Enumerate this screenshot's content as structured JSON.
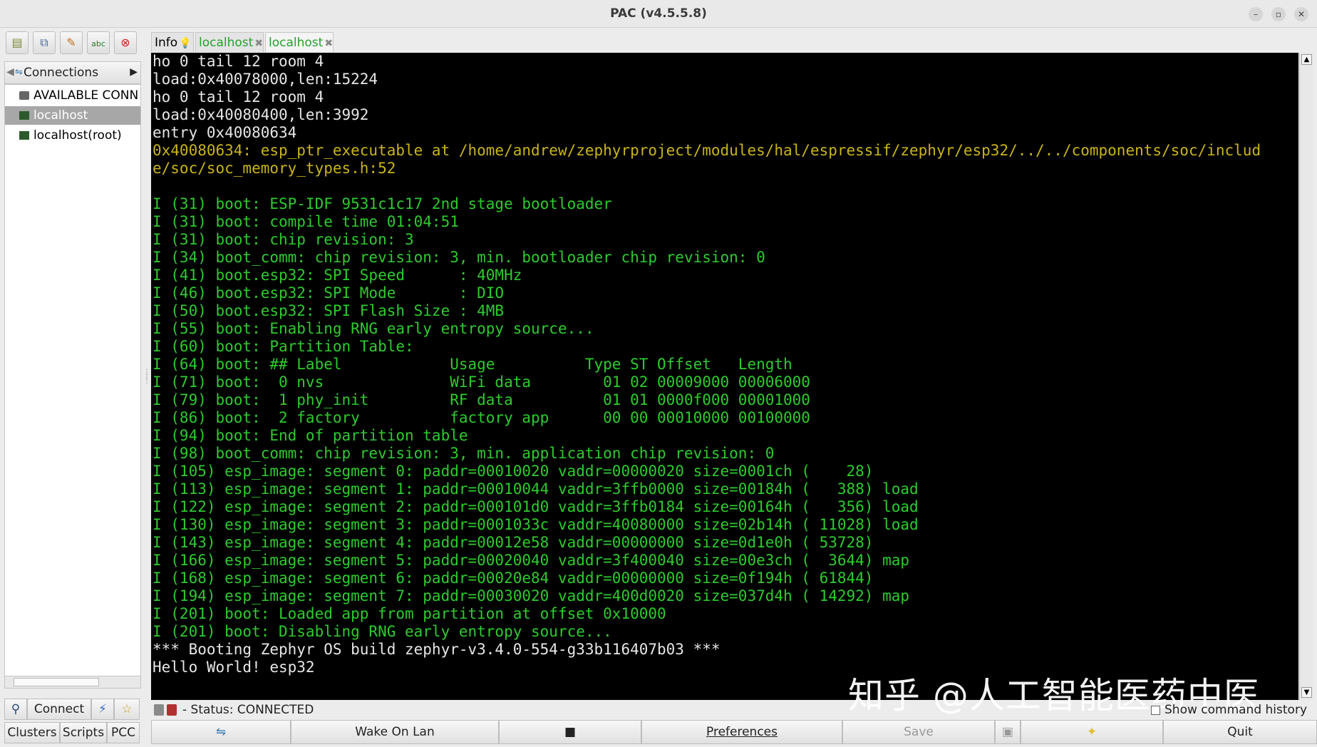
{
  "window": {
    "title": "PAC (v4.5.5.8)"
  },
  "left_panel": {
    "connections_label": "Connections",
    "tree": [
      {
        "label": "AVAILABLE CONN",
        "selected": false
      },
      {
        "label": "localhost",
        "selected": true
      },
      {
        "label": "localhost(root)",
        "selected": false
      }
    ],
    "connect_label": "Connect",
    "tabs": [
      "Clusters",
      "Scripts",
      "PCC"
    ]
  },
  "tabs": [
    {
      "label": "Info",
      "color": "#222222"
    },
    {
      "label": "localhost",
      "color": "#24a12e"
    },
    {
      "label": "localhost",
      "color": "#24a12e"
    }
  ],
  "terminal": {
    "lines": [
      {
        "text": "ho 0 tail 12 room 4",
        "color": "#e6e6e6"
      },
      {
        "text": "load:0x40078000,len:15224",
        "color": "#e6e6e6"
      },
      {
        "text": "ho 0 tail 12 room 4",
        "color": "#e6e6e6"
      },
      {
        "text": "load:0x40080400,len:3992",
        "color": "#e6e6e6"
      },
      {
        "text": "entry 0x40080634",
        "color": "#e6e6e6"
      },
      {
        "text": "0x40080634: esp_ptr_executable at /home/andrew/zephyrproject/modules/hal/espressif/zephyr/esp32/../../components/soc/includ",
        "color": "#c9b41a"
      },
      {
        "text": "e/soc/soc_memory_types.h:52",
        "color": "#c9b41a"
      },
      {
        "text": "",
        "color": "#e6e6e6"
      },
      {
        "text": "I (31) boot: ESP-IDF 9531c1c17 2nd stage bootloader",
        "color": "#2ecb2e"
      },
      {
        "text": "I (31) boot: compile time 01:04:51",
        "color": "#2ecb2e"
      },
      {
        "text": "I (31) boot: chip revision: 3",
        "color": "#2ecb2e"
      },
      {
        "text": "I (34) boot_comm: chip revision: 3, min. bootloader chip revision: 0",
        "color": "#2ecb2e"
      },
      {
        "text": "I (41) boot.esp32: SPI Speed      : 40MHz",
        "color": "#2ecb2e"
      },
      {
        "text": "I (46) boot.esp32: SPI Mode       : DIO",
        "color": "#2ecb2e"
      },
      {
        "text": "I (50) boot.esp32: SPI Flash Size : 4MB",
        "color": "#2ecb2e"
      },
      {
        "text": "I (55) boot: Enabling RNG early entropy source...",
        "color": "#2ecb2e"
      },
      {
        "text": "I (60) boot: Partition Table:",
        "color": "#2ecb2e"
      },
      {
        "text": "I (64) boot: ## Label            Usage          Type ST Offset   Length",
        "color": "#2ecb2e"
      },
      {
        "text": "I (71) boot:  0 nvs              WiFi data        01 02 00009000 00006000",
        "color": "#2ecb2e"
      },
      {
        "text": "I (79) boot:  1 phy_init         RF data          01 01 0000f000 00001000",
        "color": "#2ecb2e"
      },
      {
        "text": "I (86) boot:  2 factory          factory app      00 00 00010000 00100000",
        "color": "#2ecb2e"
      },
      {
        "text": "I (94) boot: End of partition table",
        "color": "#2ecb2e"
      },
      {
        "text": "I (98) boot_comm: chip revision: 3, min. application chip revision: 0",
        "color": "#2ecb2e"
      },
      {
        "text": "I (105) esp_image: segment 0: paddr=00010020 vaddr=00000020 size=0001ch (    28)",
        "color": "#2ecb2e"
      },
      {
        "text": "I (113) esp_image: segment 1: paddr=00010044 vaddr=3ffb0000 size=00184h (   388) load",
        "color": "#2ecb2e"
      },
      {
        "text": "I (122) esp_image: segment 2: paddr=000101d0 vaddr=3ffb0184 size=00164h (   356) load",
        "color": "#2ecb2e"
      },
      {
        "text": "I (130) esp_image: segment 3: paddr=0001033c vaddr=40080000 size=02b14h ( 11028) load",
        "color": "#2ecb2e"
      },
      {
        "text": "I (143) esp_image: segment 4: paddr=00012e58 vaddr=00000000 size=0d1e0h ( 53728)",
        "color": "#2ecb2e"
      },
      {
        "text": "I (166) esp_image: segment 5: paddr=00020040 vaddr=3f400040 size=00e3ch (  3644) map",
        "color": "#2ecb2e"
      },
      {
        "text": "I (168) esp_image: segment 6: paddr=00020e84 vaddr=00000000 size=0f194h ( 61844)",
        "color": "#2ecb2e"
      },
      {
        "text": "I (194) esp_image: segment 7: paddr=00030020 vaddr=400d0020 size=037d4h ( 14292) map",
        "color": "#2ecb2e"
      },
      {
        "text": "I (201) boot: Loaded app from partition at offset 0x10000",
        "color": "#2ecb2e"
      },
      {
        "text": "I (201) boot: Disabling RNG early entropy source...",
        "color": "#2ecb2e"
      },
      {
        "text": "*** Booting Zephyr OS build zephyr-v3.4.0-554-g33b116407b03 ***",
        "color": "#e6e6e6"
      },
      {
        "text": "Hello World! esp32",
        "color": "#e6e6e6"
      }
    ]
  },
  "watermark": "知乎 @人工智能医药中医",
  "status": {
    "text": "- Status: CONNECTED",
    "history_label": "Show command history"
  },
  "bottom_buttons": {
    "wake_on_lan": "Wake On Lan",
    "preferences": "Preferences",
    "save": "Save",
    "quit": "Quit"
  }
}
